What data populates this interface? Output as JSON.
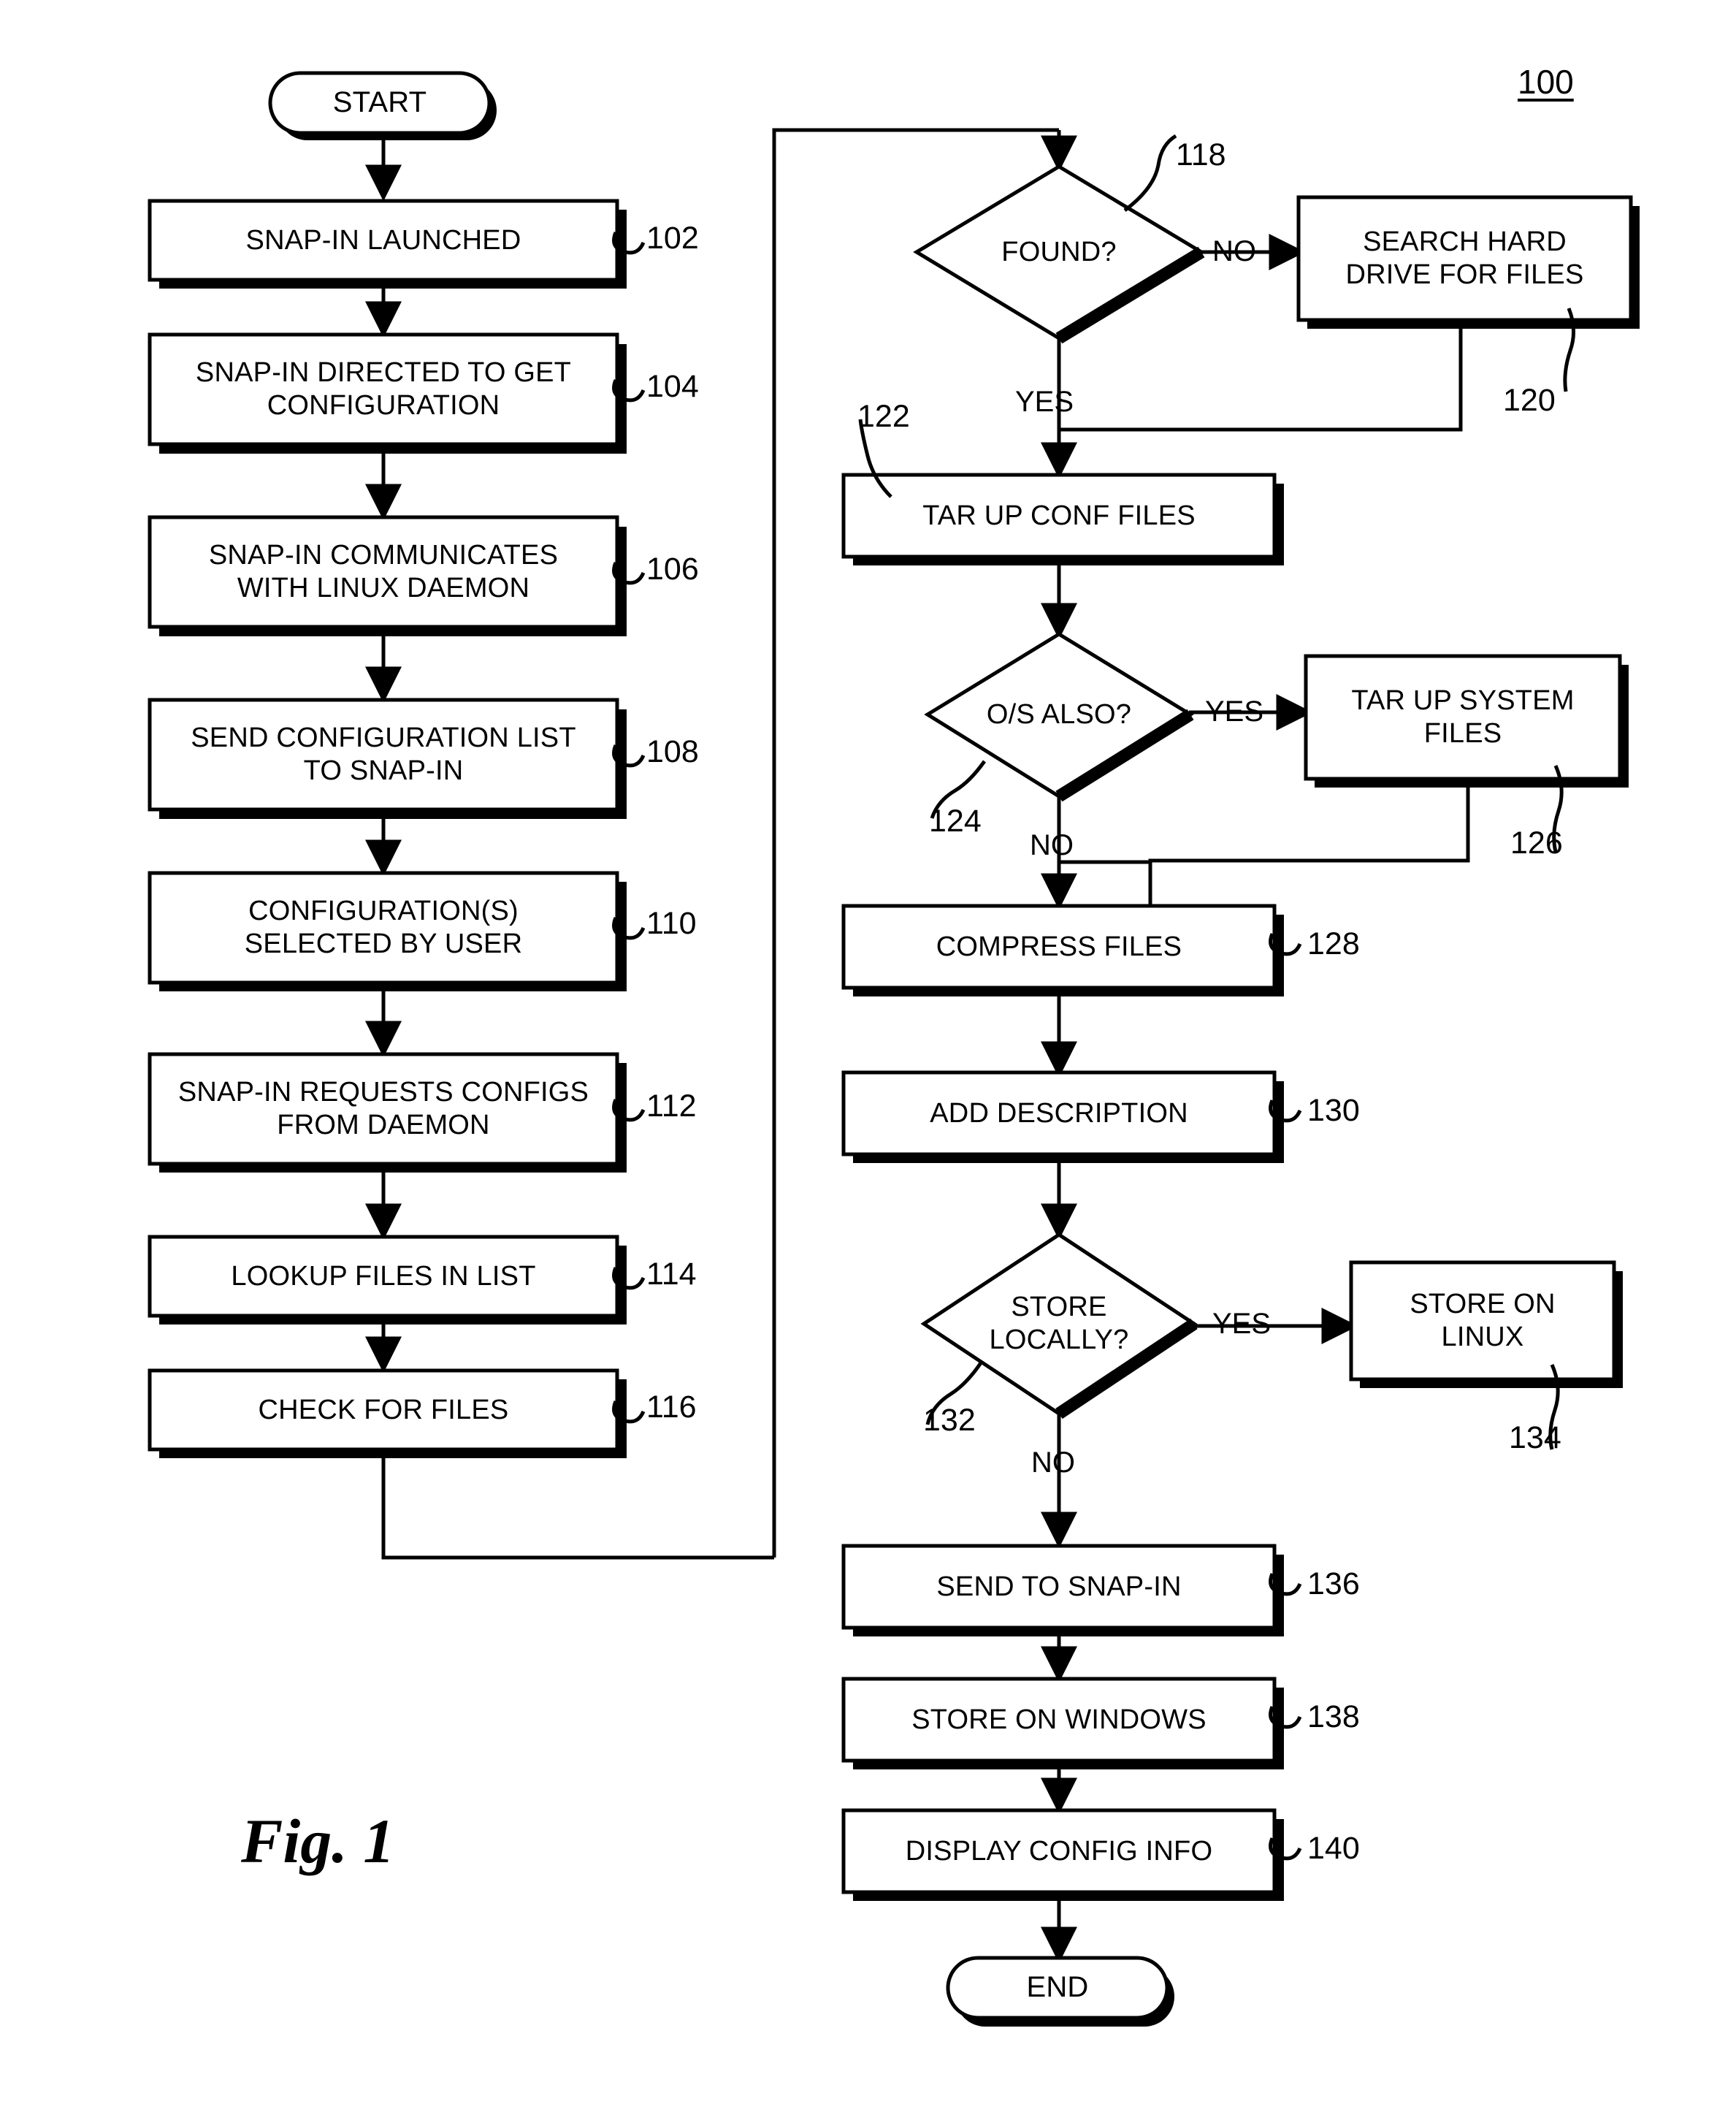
{
  "figure": {
    "caption": "Fig. 1",
    "system_ref": "100"
  },
  "nodes": {
    "start": {
      "label": "START",
      "shape": "terminator",
      "ref": ""
    },
    "n102": {
      "label": "SNAP-IN LAUNCHED",
      "shape": "process",
      "ref": "102"
    },
    "n104": {
      "label": "SNAP-IN DIRECTED TO GET\nCONFIGURATION",
      "shape": "process",
      "ref": "104"
    },
    "n106": {
      "label": "SNAP-IN COMMUNICATES\nWITH LINUX DAEMON",
      "shape": "process",
      "ref": "106"
    },
    "n108": {
      "label": "SEND CONFIGURATION LIST\nTO SNAP-IN",
      "shape": "process",
      "ref": "108"
    },
    "n110": {
      "label": "CONFIGURATION(S)\nSELECTED BY USER",
      "shape": "process",
      "ref": "110"
    },
    "n112": {
      "label": "SNAP-IN REQUESTS CONFIGS\nFROM DAEMON",
      "shape": "process",
      "ref": "112"
    },
    "n114": {
      "label": "LOOKUP FILES IN LIST",
      "shape": "process",
      "ref": "114"
    },
    "n116": {
      "label": "CHECK FOR FILES",
      "shape": "process",
      "ref": "116"
    },
    "n118": {
      "label": "FOUND?",
      "shape": "decision",
      "ref": "118"
    },
    "n120": {
      "label": "SEARCH HARD\nDRIVE FOR FILES",
      "shape": "process",
      "ref": "120"
    },
    "n122": {
      "label": "TAR UP CONF FILES",
      "shape": "process",
      "ref": "122"
    },
    "n124": {
      "label": "O/S ALSO?",
      "shape": "decision",
      "ref": "124"
    },
    "n126": {
      "label": "TAR UP SYSTEM\nFILES",
      "shape": "process",
      "ref": "126"
    },
    "n128": {
      "label": "COMPRESS FILES",
      "shape": "process",
      "ref": "128"
    },
    "n130": {
      "label": "ADD DESCRIPTION",
      "shape": "process",
      "ref": "130"
    },
    "n132": {
      "label": "STORE\nLOCALLY?",
      "shape": "decision",
      "ref": "132"
    },
    "n134": {
      "label": "STORE ON\nLINUX",
      "shape": "process",
      "ref": "134"
    },
    "n136": {
      "label": "SEND TO SNAP-IN",
      "shape": "process",
      "ref": "136"
    },
    "n138": {
      "label": "STORE ON WINDOWS",
      "shape": "process",
      "ref": "138"
    },
    "n140": {
      "label": "DISPLAY CONFIG INFO",
      "shape": "process",
      "ref": "140"
    },
    "end": {
      "label": "END",
      "shape": "terminator",
      "ref": ""
    }
  },
  "edge_labels": {
    "found_no": "NO",
    "found_yes": "YES",
    "os_yes": "YES",
    "os_no": "NO",
    "store_yes": "YES",
    "store_no": "NO"
  },
  "colors": {
    "stroke": "#000000",
    "fill": "#ffffff",
    "shadow": "#000000"
  }
}
